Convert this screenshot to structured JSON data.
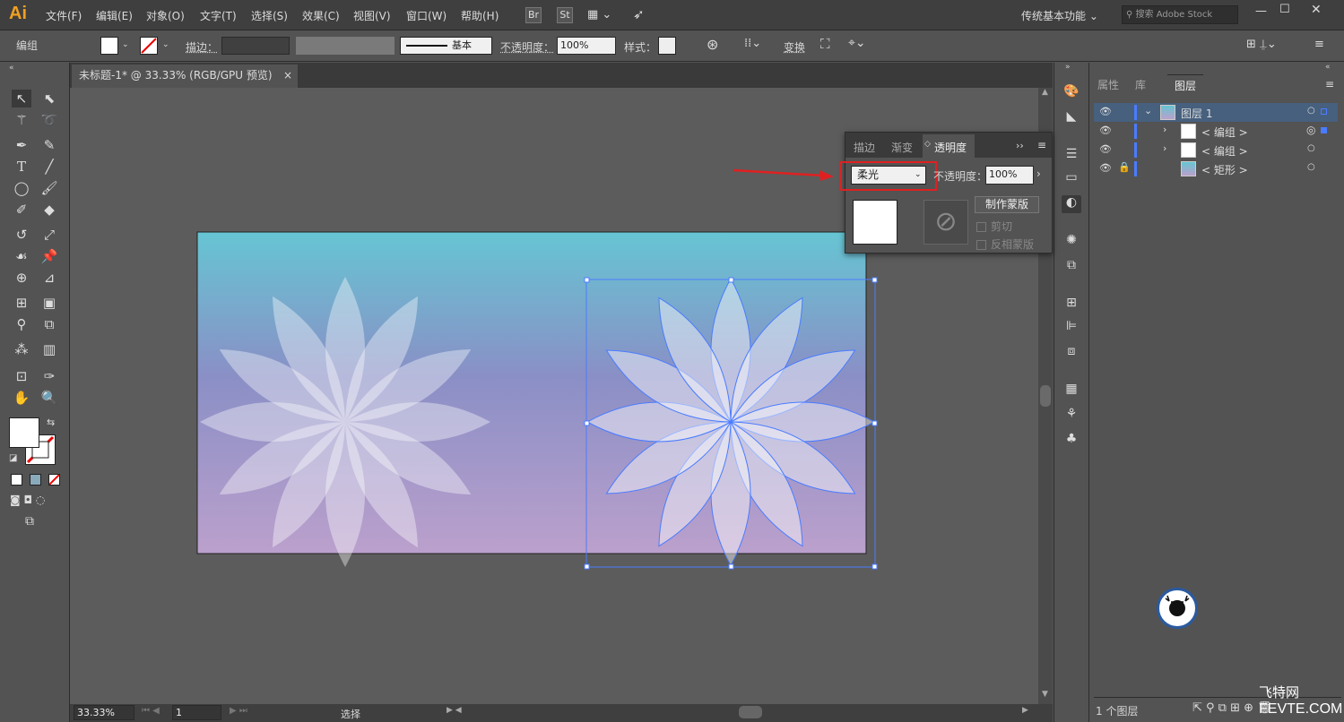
{
  "app": {
    "logo": "Ai",
    "menus": [
      "文件(F)",
      "编辑(E)",
      "对象(O)",
      "文字(T)",
      "选择(S)",
      "效果(C)",
      "视图(V)",
      "窗口(W)",
      "帮助(H)"
    ],
    "bridge": "Br",
    "stock": "St",
    "workspace": "传统基本功能",
    "search_placeholder": "搜索 Adobe Stock"
  },
  "control": {
    "group_label": "编组",
    "stroke_label": "描边：",
    "stroke_profile": "基本",
    "opacity_label": "不透明度：",
    "opacity_value": "100%",
    "style_label": "样式：",
    "transform_label": "变换"
  },
  "document": {
    "tab_title": "未标题-1* @ 33.33% (RGB/GPU 预览)",
    "close": "×"
  },
  "transparency_panel": {
    "tabs": [
      "描边",
      "渐变",
      "透明度"
    ],
    "blend_mode": "柔光",
    "opacity_label": "不透明度：",
    "opacity_value": "100%",
    "make_mask": "制作蒙版",
    "clip": "剪切",
    "invert_mask": "反相蒙版"
  },
  "layers_panel": {
    "tabs": [
      "属性",
      "库",
      "图层"
    ],
    "rows": [
      {
        "name": "图层 1",
        "level": 0
      },
      {
        "name": "< 编组 >",
        "level": 1
      },
      {
        "name": "< 编组 >",
        "level": 1
      },
      {
        "name": "< 矩形 >",
        "level": 1
      }
    ],
    "footer": "1 个图层"
  },
  "status": {
    "zoom": "33.33%",
    "page": "1",
    "tool": "选择"
  },
  "watermark": {
    "text": "飞特网",
    "url": "FEVTE.COM"
  },
  "colors": {
    "gradient_top": "#66c5d3",
    "gradient_mid": "#8a8fc6",
    "gradient_bottom": "#bba0cc",
    "selection": "#4a7cff",
    "highlight_box": "#e02020",
    "arrow": "#e02020"
  }
}
